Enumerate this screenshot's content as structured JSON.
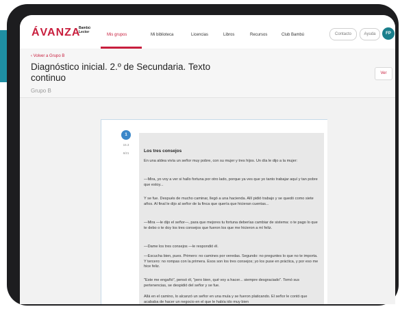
{
  "brand": {
    "name": "ÁVANZA",
    "sub1": "Bambú",
    "sub2": "Lector"
  },
  "nav": {
    "items": [
      "Mis grupos",
      "Mi biblioteca",
      "Licencias",
      "Libros",
      "Recursos",
      "Club Bambú"
    ],
    "active": "Mis grupos"
  },
  "header_actions": {
    "contact": "Contacto",
    "help": "Ayuda",
    "avatar": "FP"
  },
  "breadcrumb": "‹ Volver a Grupo B",
  "page": {
    "title_line1": "Diagnóstico inicial. 2.º de Secundaria. Texto",
    "title_line2": "continuo",
    "group": "Grupo B",
    "view_button": "Ver"
  },
  "doc_sidebar": {
    "question_number": "1",
    "meta1": "15.3",
    "meta2": "6/21"
  },
  "document": {
    "title": "Los tres consejos",
    "paragraphs": [
      "En una aldea vivía un señor muy pobre, con su mujer y tres hijos. Un día le dijo a la mujer:",
      "—Mira, yo voy a ver si hallo fortuna por otro lado, porque ya ves que yo tanto trabajar aquí y tan pobre que estoy...",
      "Y se fue. Después de mucho caminar, llegó a una hacienda. Allí pidió trabajo y se quedó como siete años. Al final le dijo al señor de la finca que quería que hicieran cuentas...",
      "—Mira —le dijo el señor—, para que mejores tu fortuna deberías cambiar de sistema: o te pago lo que te debo o te doy los tres consejos que fueron los que me hicieron a mí feliz.",
      "—Dame los tres consejos —le respondió él.",
      "—Escucha bien, pues. Primero: no camines por veredas. Segundo: no preguntes lo que no te importa. Y tercero: no rompas con la primera. Esos son los tres consejos; yo los puse en práctica, y por eso me hice feliz.",
      "\"Este me engañó\", pensó él, \"pero bien, qué voy a hacer... siempre desgraciado\". Tomó sus pertenencias, se despidió del señor y se fue.",
      "Allá en el camino, lo alcanzó un señor en una mula y se fueron platicando. El señor le contó que acababa de hacer un negocio en el que le había ido muy bien"
    ]
  },
  "colors": {
    "brand_red": "#c81e3d",
    "teal": "#1f8fa3",
    "badge_blue": "#3a87c9",
    "device_frame": "#1d1d1f"
  }
}
